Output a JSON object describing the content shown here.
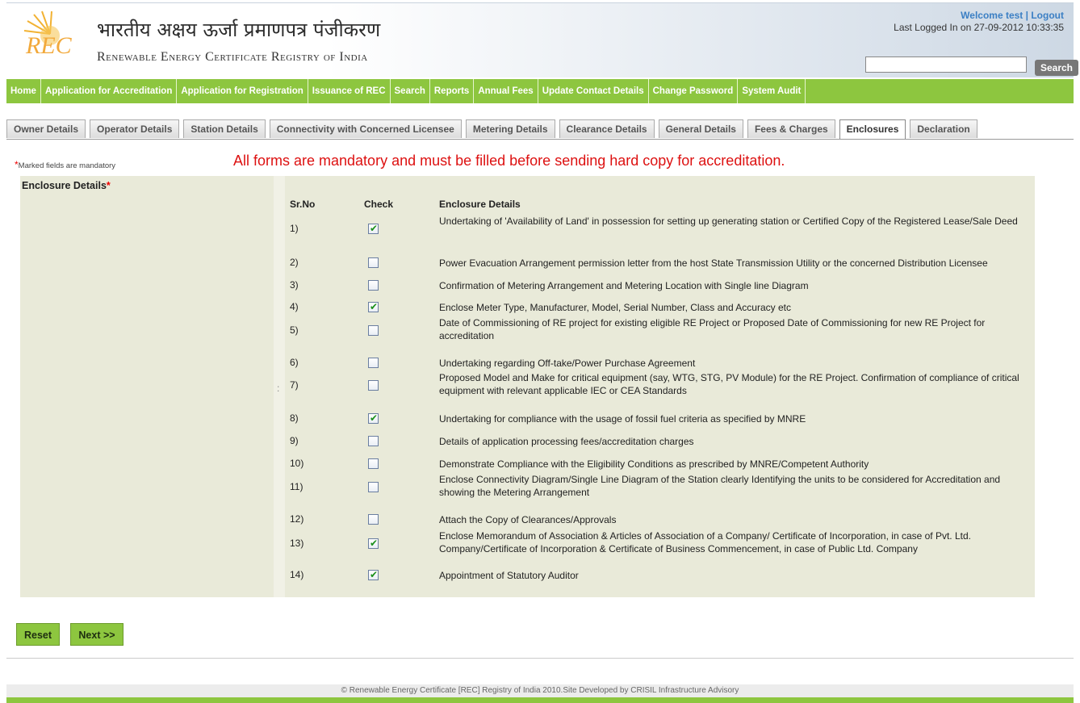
{
  "header": {
    "title_hindi": "भारतीय अक्षय ऊर्जा प्रमाणपत्र पंजीकरण",
    "title_english": "Renewable Energy Certificate Registry of India",
    "logo_text": "REC",
    "welcome": "Welcome test",
    "logout": "Logout",
    "last_logged_in": "Last Logged In on 27-09-2012 10:33:35",
    "search_placeholder": "",
    "search_button": "Search"
  },
  "nav": [
    "Home",
    "Application for Accreditation",
    "Application for Registration",
    "Issuance of REC",
    "Search",
    "Reports",
    "Annual Fees",
    "Update Contact Details",
    "Change Password",
    "System Audit"
  ],
  "tabs": [
    {
      "label": "Owner Details",
      "active": false
    },
    {
      "label": "Operator Details",
      "active": false
    },
    {
      "label": "Station Details",
      "active": false
    },
    {
      "label": "Connectivity with Concerned Licensee",
      "active": false
    },
    {
      "label": "Metering Details",
      "active": false
    },
    {
      "label": "Clearance Details",
      "active": false
    },
    {
      "label": "General Details",
      "active": false
    },
    {
      "label": "Fees & Charges",
      "active": false
    },
    {
      "label": "Enclosures",
      "active": true
    },
    {
      "label": "Declaration",
      "active": false
    }
  ],
  "form": {
    "mandatory_note": "Marked fields are mandatory",
    "banner": "All forms are mandatory and must be filled before sending hard copy for accreditation.",
    "section_label": "Enclosure Details",
    "col_srno": "Sr.No",
    "col_check": "Check",
    "col_details": "Enclosure Details",
    "rows": [
      {
        "no": "1)",
        "checked": true,
        "text": "Undertaking of 'Availability of Land' in possession for setting up generating station or Certified Copy of the Registered Lease/Sale Deed"
      },
      {
        "no": "2)",
        "checked": false,
        "text": "Power Evacuation Arrangement permission letter from the host State Transmission Utility or the concerned Distribution Licensee"
      },
      {
        "no": "3)",
        "checked": false,
        "text": "Confirmation of Metering Arrangement and Metering Location with Single line Diagram"
      },
      {
        "no": "4)",
        "checked": true,
        "text": "Enclose Meter Type, Manufacturer, Model, Serial Number, Class and Accuracy etc"
      },
      {
        "no": "5)",
        "checked": false,
        "text": "Date of Commissioning of RE project for existing eligible RE Project or Proposed Date of Commissioning for new RE Project for accreditation"
      },
      {
        "no": "6)",
        "checked": false,
        "text": "Undertaking regarding Off-take/Power Purchase Agreement"
      },
      {
        "no": "7)",
        "checked": false,
        "text": "Proposed Model and Make for critical equipment (say, WTG, STG, PV Module) for the RE Project. Confirmation of compliance of critical equipment with relevant applicable IEC or CEA Standards"
      },
      {
        "no": "8)",
        "checked": true,
        "text": "Undertaking for compliance with the usage of fossil fuel criteria as specified by MNRE"
      },
      {
        "no": "9)",
        "checked": false,
        "text": "Details of application processing fees/accreditation charges"
      },
      {
        "no": "10)",
        "checked": false,
        "text": "Demonstrate Compliance with the Eligibility Conditions as prescribed by MNRE/Competent Authority"
      },
      {
        "no": "11)",
        "checked": false,
        "text": "Enclose Connectivity Diagram/Single Line Diagram of the Station clearly Identifying the units to be considered for Accreditation and showing the Metering Arrangement"
      },
      {
        "no": "12)",
        "checked": false,
        "text": "Attach the Copy of Clearances/Approvals"
      },
      {
        "no": "13)",
        "checked": true,
        "text": "Enclose Memorandum of Association & Articles of Association of a Company/ Certificate of Incorporation, in case of Pvt. Ltd. Company/Certificate of Incorporation & Certificate of Business Commencement, in case of Public Ltd. Company"
      },
      {
        "no": "14)",
        "checked": true,
        "text": "Appointment of Statutory Auditor"
      }
    ]
  },
  "buttons": {
    "reset": "Reset",
    "next": "Next >>"
  },
  "footer": "© Renewable Energy Certificate [REC] Registry of India 2010.Site Developed by CRISIL Infrastructure Advisory",
  "colors": {
    "nav_green": "#8dc63f",
    "banner_red": "#dd1111",
    "panel_bg": "#e9ead9",
    "link_blue": "#3b7fc4"
  }
}
